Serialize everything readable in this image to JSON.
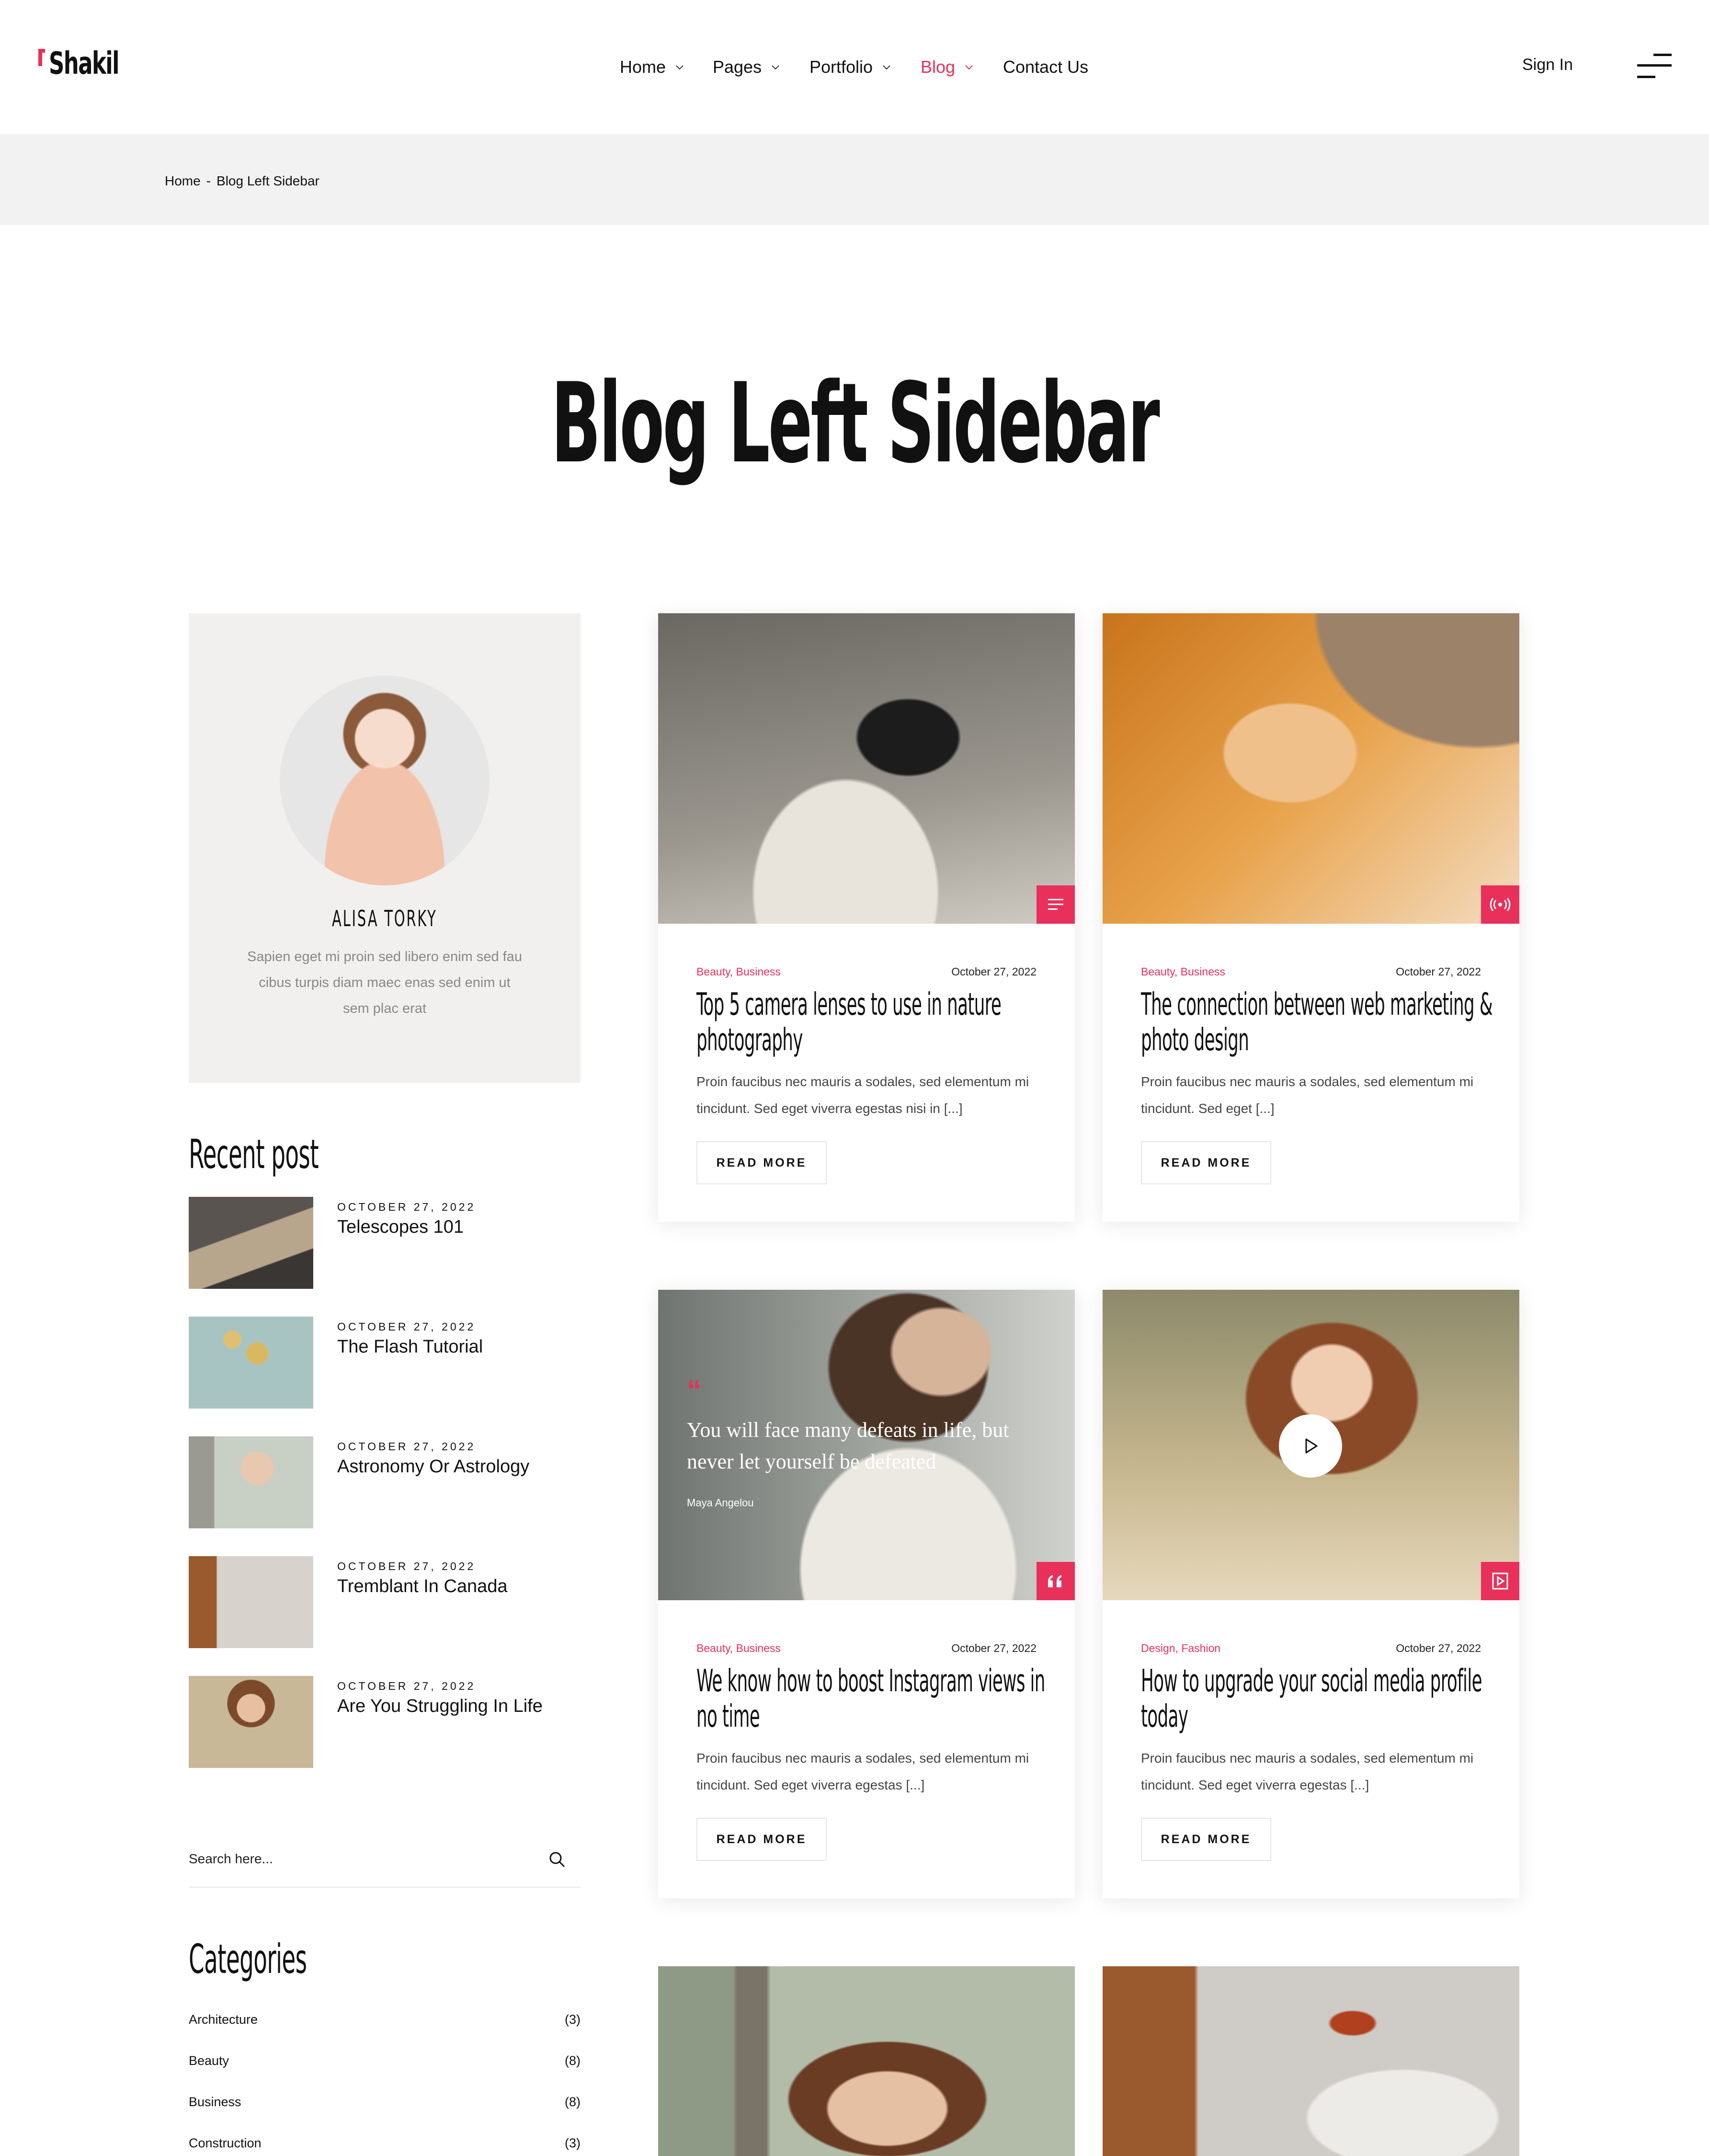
{
  "brand": {
    "name": "Shakil",
    "accent": "#e8305a"
  },
  "nav": {
    "items": [
      {
        "label": "Home"
      },
      {
        "label": "Pages"
      },
      {
        "label": "Portfolio"
      },
      {
        "label": "Blog"
      },
      {
        "label": "Contact Us"
      }
    ],
    "active": "Blog",
    "sign_in": "Sign In"
  },
  "breadcrumb": {
    "home": "Home",
    "sep": "-",
    "current": "Blog Left Sidebar"
  },
  "page_title": "Blog Left Sidebar",
  "about": {
    "name": "ALISA TORKY",
    "text": "Sapien eget mi proin sed libero enim sed fau cibus turpis diam maec enas sed enim ut sem plac erat"
  },
  "recent": {
    "heading": "Recent post",
    "posts": [
      {
        "date": "OCTOBER 27, 2022",
        "title": "Telescopes 101"
      },
      {
        "date": "OCTOBER 27, 2022",
        "title": "The Flash Tutorial"
      },
      {
        "date": "OCTOBER 27, 2022",
        "title": "Astronomy Or Astrology"
      },
      {
        "date": "OCTOBER 27, 2022",
        "title": "Tremblant In Canada"
      },
      {
        "date": "OCTOBER 27, 2022",
        "title": "Are You Struggling In Life"
      }
    ]
  },
  "search": {
    "placeholder": "Search here..."
  },
  "categories": {
    "heading": "Categories",
    "items": [
      {
        "name": "Architecture",
        "count": "(3)"
      },
      {
        "name": "Beauty",
        "count": "(8)"
      },
      {
        "name": "Business",
        "count": "(8)"
      },
      {
        "name": "Construction",
        "count": "(3)"
      }
    ]
  },
  "posts": [
    {
      "cats": "Beauty, Business",
      "date": "October 27, 2022",
      "title": "Top 5 camera lenses to use in nature photography",
      "excerpt": "Proin faucibus nec mauris a sodales, sed elementum mi tincidunt. Sed eget viverra egestas nisi in [...]",
      "button": "READ MORE",
      "format_icon": "text-lines-icon"
    },
    {
      "cats": "Beauty, Business",
      "date": "October 27, 2022",
      "title": "The connection between web marketing & photo design",
      "excerpt": "Proin faucibus nec mauris a sodales, sed elementum mi tincidunt. Sed eget [...]",
      "button": "READ MORE",
      "format_icon": "broadcast-icon"
    },
    {
      "cats": "Beauty, Business",
      "date": "October 27, 2022",
      "title": "We know how to boost Instagram views in no time",
      "excerpt": "Proin faucibus nec mauris a sodales, sed elementum mi tincidunt. Sed eget viverra egestas [...]",
      "button": "READ MORE",
      "format_icon": "quote-icon",
      "quote": {
        "mark": "“",
        "text": "You will face many defeats in life, but never let yourself be defeated",
        "author": "Maya Angelou"
      }
    },
    {
      "cats": "Design, Fashion",
      "date": "October 27, 2022",
      "title": "How to upgrade your social media profile today",
      "excerpt": "Proin faucibus nec mauris a sodales, sed elementum mi tincidunt. Sed eget viverra egestas [...]",
      "button": "READ MORE",
      "format_icon": "video-icon"
    }
  ]
}
